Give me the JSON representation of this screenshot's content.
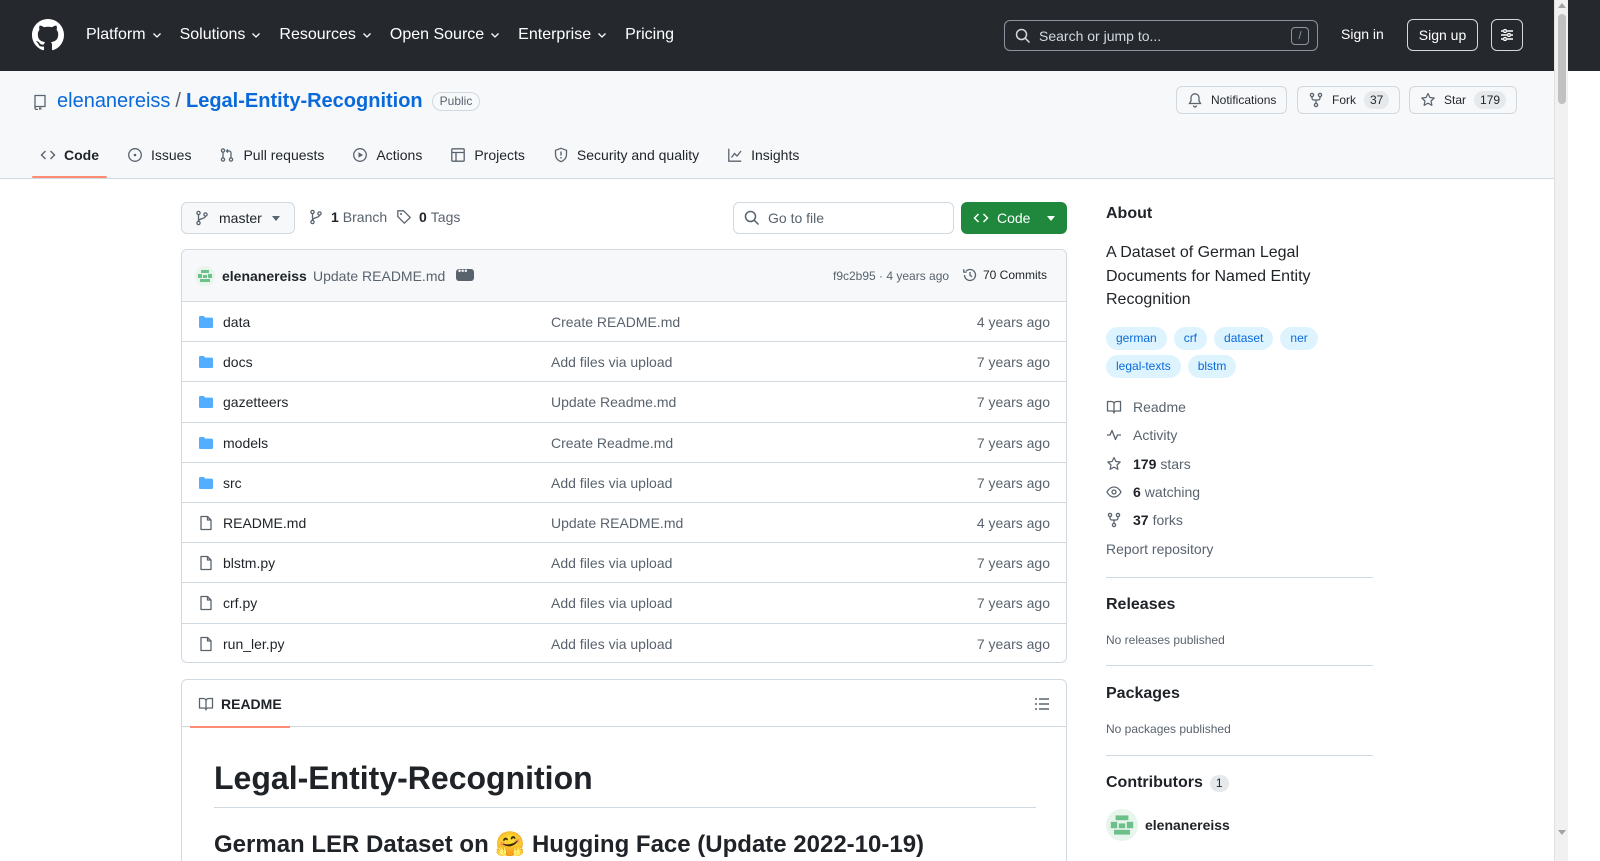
{
  "global_header": {
    "nav": [
      {
        "label": "Platform",
        "has_menu": true
      },
      {
        "label": "Solutions",
        "has_menu": true
      },
      {
        "label": "Resources",
        "has_menu": true
      },
      {
        "label": "Open Source",
        "has_menu": true
      },
      {
        "label": "Enterprise",
        "has_menu": true
      },
      {
        "label": "Pricing",
        "has_menu": false
      }
    ],
    "search_placeholder": "Search or jump to...",
    "search_shortcut": "/",
    "sign_in": "Sign in",
    "sign_up": "Sign up"
  },
  "repo": {
    "owner": "elenanereiss",
    "separator": "/",
    "name": "Legal-Entity-Recognition",
    "visibility": "Public",
    "notifications_label": "Notifications",
    "fork_label": "Fork",
    "fork_count": "37",
    "star_label": "Star",
    "star_count": "179",
    "tabs": [
      {
        "label": "Code",
        "icon": "code-icon",
        "active": true
      },
      {
        "label": "Issues",
        "icon": "issue-icon",
        "active": false
      },
      {
        "label": "Pull requests",
        "icon": "pull-request-icon",
        "active": false
      },
      {
        "label": "Actions",
        "icon": "play-icon",
        "active": false
      },
      {
        "label": "Projects",
        "icon": "table-icon",
        "active": false
      },
      {
        "label": "Security and quality",
        "icon": "shield-icon",
        "active": false
      },
      {
        "label": "Insights",
        "icon": "graph-icon",
        "active": false
      }
    ]
  },
  "file_nav": {
    "branch": "master",
    "branch_count": "1",
    "branch_label": "Branch",
    "tag_count": "0",
    "tag_label": "Tags",
    "goto_placeholder": "Go to file",
    "code_button": "Code"
  },
  "latest_commit": {
    "author": "elenanereiss",
    "message": "Update README.md",
    "sha_age": "f9c2b95 · 4 years ago",
    "commits": "70 Commits"
  },
  "files": [
    {
      "type": "folder",
      "name": "data",
      "message": "Create README.md",
      "age": "4 years ago"
    },
    {
      "type": "folder",
      "name": "docs",
      "message": "Add files via upload",
      "age": "7 years ago"
    },
    {
      "type": "folder",
      "name": "gazetteers",
      "message": "Update Readme.md",
      "age": "7 years ago"
    },
    {
      "type": "folder",
      "name": "models",
      "message": "Create Readme.md",
      "age": "7 years ago"
    },
    {
      "type": "folder",
      "name": "src",
      "message": "Add files via upload",
      "age": "7 years ago"
    },
    {
      "type": "file",
      "name": "README.md",
      "message": "Update README.md",
      "age": "4 years ago"
    },
    {
      "type": "file",
      "name": "blstm.py",
      "message": "Add files via upload",
      "age": "7 years ago"
    },
    {
      "type": "file",
      "name": "crf.py",
      "message": "Add files via upload",
      "age": "7 years ago"
    },
    {
      "type": "file",
      "name": "run_ler.py",
      "message": "Add files via upload",
      "age": "7 years ago"
    }
  ],
  "readme": {
    "tab_label": "README",
    "h1": "Legal-Entity-Recognition",
    "h2": "German LER Dataset on 🤗 Hugging Face (Update 2022-10-19)"
  },
  "sidebar": {
    "about_title": "About",
    "description": "A Dataset of German Legal Documents for Named Entity Recognition",
    "topics": [
      "german",
      "crf",
      "dataset",
      "ner",
      "legal-texts",
      "blstm"
    ],
    "readme_link": "Readme",
    "activity_link": "Activity",
    "stars_count": "179",
    "stars_label": "stars",
    "watching_count": "6",
    "watching_label": "watching",
    "forks_count": "37",
    "forks_label": "forks",
    "report_link": "Report repository",
    "releases_title": "Releases",
    "releases_note": "No releases published",
    "packages_title": "Packages",
    "packages_note": "No packages published",
    "contributors_title": "Contributors",
    "contributors_count": "1",
    "contributor_name": "elenanereiss"
  },
  "colors": {
    "header_bg": "#25292e",
    "link": "#0969da",
    "primary_button": "#1f883d",
    "active_tab_underline": "#fd8c73",
    "folder_icon": "#54aeff",
    "topic_bg": "#ddf4ff"
  }
}
